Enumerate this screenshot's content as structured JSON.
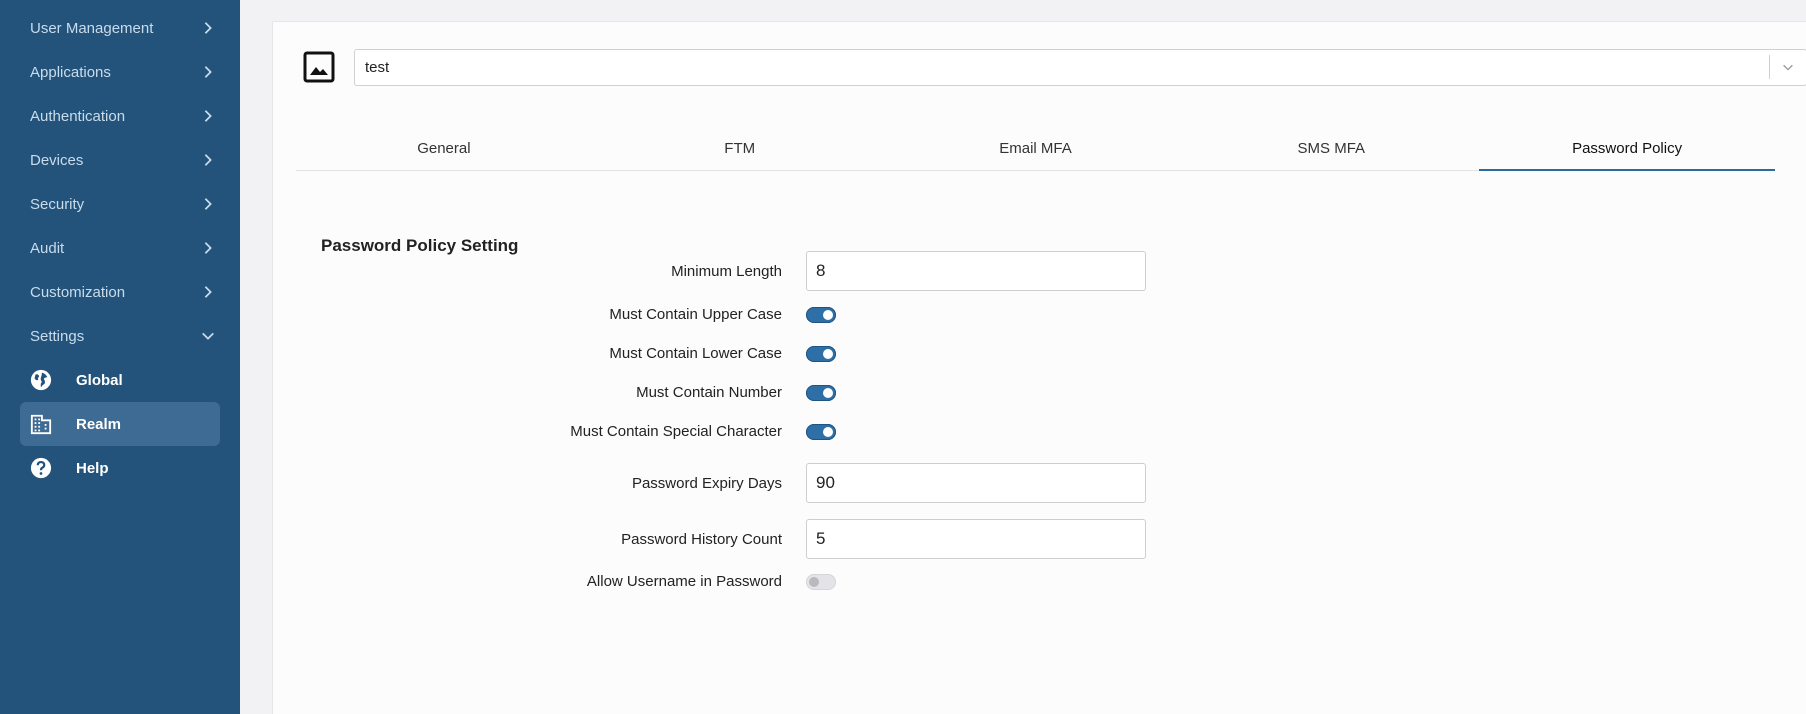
{
  "sidebar": {
    "items": [
      {
        "label": "User Management"
      },
      {
        "label": "Applications"
      },
      {
        "label": "Authentication"
      },
      {
        "label": "Devices"
      },
      {
        "label": "Security"
      },
      {
        "label": "Audit"
      },
      {
        "label": "Customization"
      },
      {
        "label": "Settings"
      }
    ],
    "sub_items": [
      {
        "label": "Global",
        "icon": "globe-icon"
      },
      {
        "label": "Realm",
        "icon": "building-icon",
        "active": true
      },
      {
        "label": "Help",
        "icon": "help-icon"
      }
    ]
  },
  "realm": {
    "icon": "image-icon",
    "selected": "test"
  },
  "tabs": [
    {
      "label": "General"
    },
    {
      "label": "FTM"
    },
    {
      "label": "Email MFA"
    },
    {
      "label": "SMS MFA"
    },
    {
      "label": "Password Policy",
      "active": true
    }
  ],
  "section": {
    "title": "Password Policy Setting"
  },
  "form": {
    "min_length": {
      "label": "Minimum Length",
      "value": "8"
    },
    "upper_case": {
      "label": "Must Contain Upper Case",
      "enabled": true
    },
    "lower_case": {
      "label": "Must Contain Lower Case",
      "enabled": true
    },
    "number": {
      "label": "Must Contain Number",
      "enabled": true
    },
    "special_char": {
      "label": "Must Contain Special Character",
      "enabled": true
    },
    "expiry_days": {
      "label": "Password Expiry Days",
      "value": "90"
    },
    "history_count": {
      "label": "Password History Count",
      "value": "5"
    },
    "allow_username": {
      "label": "Allow Username in Password",
      "enabled": false
    }
  },
  "colors": {
    "sidebar_bg": "#23537a",
    "active_item_bg": "#3e6b93",
    "accent": "#2d6a9e",
    "toggle_on": "#2f6fa8"
  }
}
